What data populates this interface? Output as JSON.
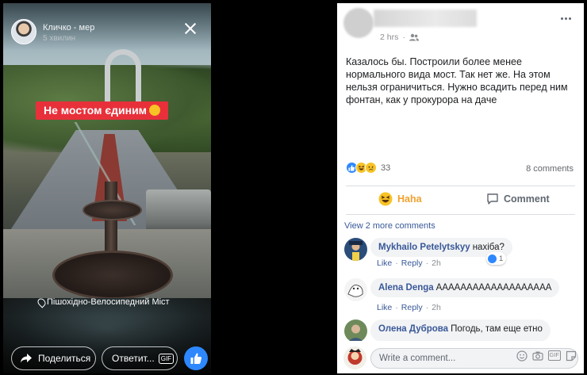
{
  "story": {
    "author": "Кличко - мер",
    "time": "5 хвилин",
    "caption": "Не мостом єдиним",
    "location": "Пішохідно-Велосипедний Міст",
    "share_label": "Поделиться",
    "reply_label": "Ответит...",
    "gif_label": "GIF"
  },
  "post": {
    "time": "2 hrs",
    "body": "Казалось бы. Построили более менее нормального вида мост. Так нет же. На этом нельзя ограничиться. Нужно всадить перед ним фонтан, как у прокурора на даче",
    "reaction_count": "33",
    "comment_count": "8 comments",
    "haha_label": "Haha",
    "comment_label": "Comment",
    "view_more": "View 2 more comments",
    "comments": [
      {
        "name": "Mykhailo Petelytskyy",
        "text": "нахіба?",
        "like": "Like",
        "reply": "Reply",
        "time": "2h",
        "reactions": "1"
      },
      {
        "name": "Alena Denga",
        "text": "ААААААААААААААААААА",
        "like": "Like",
        "reply": "Reply",
        "time": "2h"
      },
      {
        "name": "Олена Дуброва",
        "text": "Погодь, там еще етно",
        "like": "Like",
        "reply": "Reply",
        "time": "2h"
      }
    ],
    "composer_placeholder": "Write a comment...",
    "composer_gif": "GIF"
  },
  "colors": {
    "fb_link": "#385898",
    "haha": "#f0a12c",
    "like_blue": "#2d88ff",
    "caption_red": "#e8303a"
  }
}
